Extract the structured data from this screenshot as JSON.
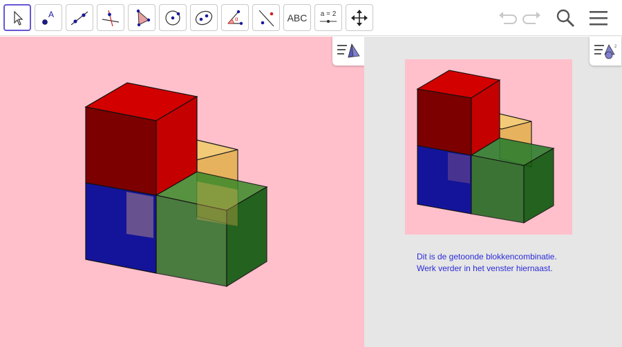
{
  "toolbar": {
    "tools": [
      {
        "name": "move",
        "icon": "cursor-arrow-icon"
      },
      {
        "name": "point",
        "icon": "point-icon",
        "label": "A"
      },
      {
        "name": "line",
        "icon": "line-icon"
      },
      {
        "name": "perpendicular",
        "icon": "perpendicular-line-icon"
      },
      {
        "name": "polygon",
        "icon": "polygon-icon"
      },
      {
        "name": "circle",
        "icon": "circle-icon"
      },
      {
        "name": "ellipse",
        "icon": "ellipse-icon"
      },
      {
        "name": "angle",
        "icon": "angle-icon",
        "label": "α"
      },
      {
        "name": "reflect",
        "icon": "reflect-icon"
      },
      {
        "name": "text",
        "icon": "text-icon",
        "label": "ABC"
      },
      {
        "name": "slider",
        "icon": "slider-icon",
        "label": "a = 2"
      },
      {
        "name": "move-view",
        "icon": "move-graphics-view-icon"
      }
    ],
    "undo_icon": "undo-icon",
    "redo_icon": "redo-icon",
    "search_icon": "search-icon",
    "menu_icon": "hamburger-menu-icon"
  },
  "right_panel": {
    "text_line_1": "Dit is de getoonde blokkencombinatie.",
    "text_line_2": "Werk verder in het venster hiernaast."
  },
  "colors": {
    "background_pink": "#ffc0cb",
    "red_cube": "#cc0000",
    "blue_cube": "#101090",
    "green_cube": "#0a6a0a",
    "orange_cube": "#f0c060",
    "text_blue": "#2b2bd9",
    "accent": "#6557d2"
  }
}
